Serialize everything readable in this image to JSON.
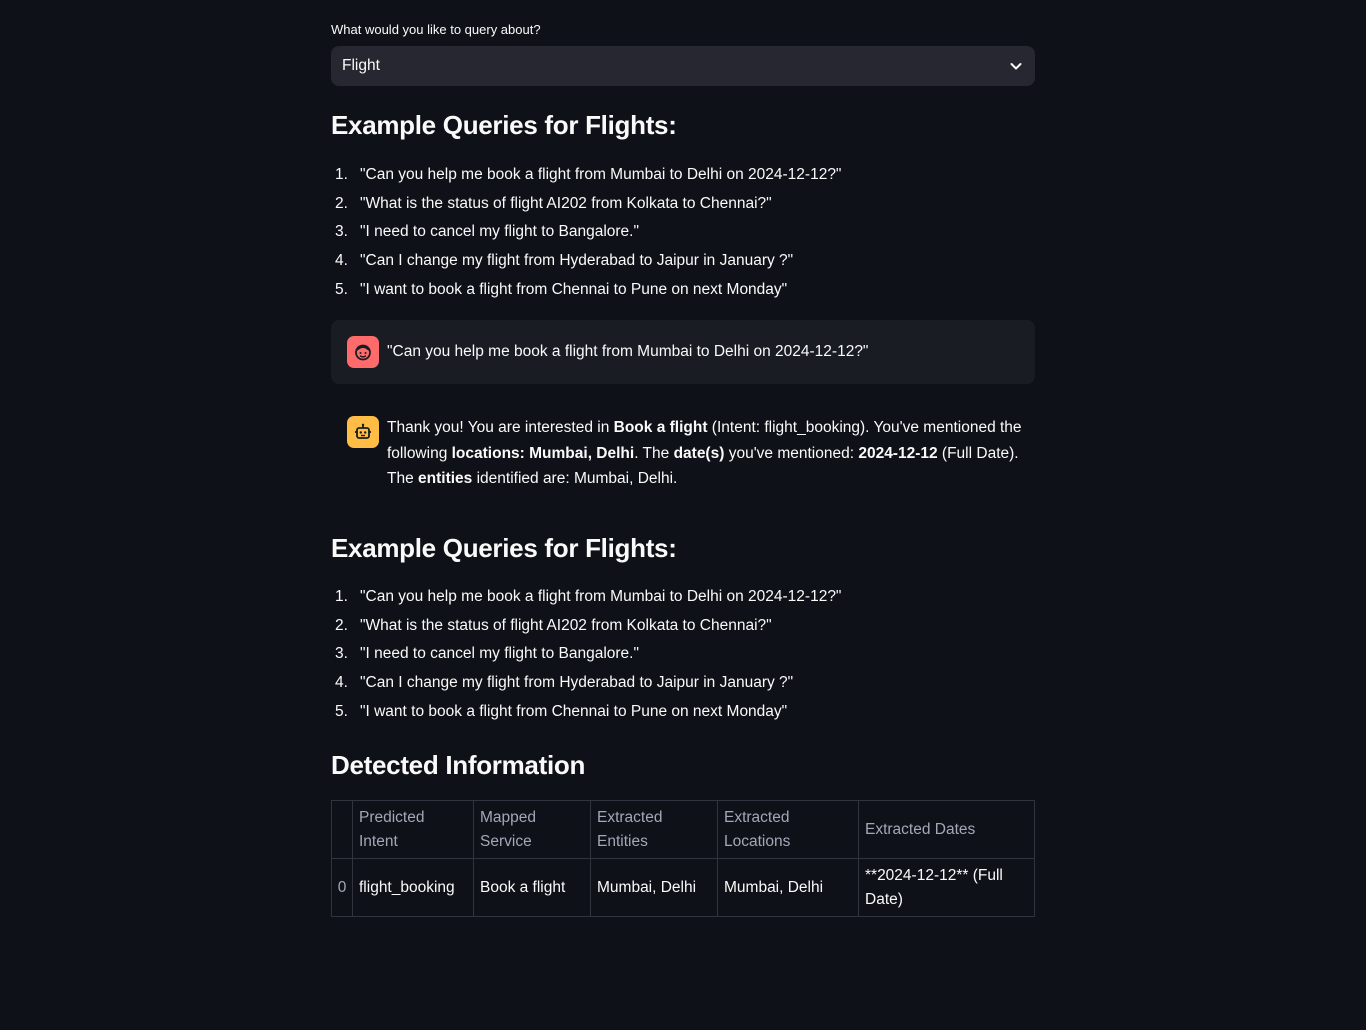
{
  "selector": {
    "label": "What would you like to query about?",
    "value": "Flight"
  },
  "examples": {
    "heading": "Example Queries for Flights:",
    "items": [
      "\"Can you help me book a flight from Mumbai to Delhi on 2024-12-12?\"",
      "\"What is the status of flight AI202 from Kolkata to Chennai?\"",
      "\"I need to cancel my flight to Bangalore.\"",
      "\"Can I change my flight from Hyderabad to Jaipur in January ?\"",
      "\"I want to book a flight from Chennai to Pune on next Monday\""
    ],
    "numbers": [
      "1.",
      "2.",
      "3.",
      "4.",
      "5."
    ]
  },
  "chat": {
    "user_message": "\"Can you help me book a flight from Mumbai to Delhi on 2024-12-12?\"",
    "bot": {
      "t1": "Thank you! You are interested in ",
      "b1": "Book a flight",
      "t2": " (Intent: flight_booking). You've mentioned the following ",
      "b2": "locations: Mumbai, Delhi",
      "t3": ". The ",
      "b3": "date(s)",
      "t4": " you've mentioned: ",
      "b4": "2024-12-12",
      "t5": " (Full Date). The ",
      "b5": "entities",
      "t6": " identified are: Mumbai, Delhi."
    }
  },
  "detected": {
    "heading": "Detected Information",
    "columns": [
      "Predicted Intent",
      "Mapped Service",
      "Extracted Entities",
      "Extracted Locations",
      "Extracted Dates"
    ],
    "row": {
      "index": "0",
      "cells": [
        "flight_booking",
        "Book a flight",
        "Mumbai, Delhi",
        "Mumbai, Delhi",
        "**2024-12-12** (Full Date)"
      ]
    }
  },
  "colors": {
    "background": "#0e1117",
    "user_avatar": "#ff6b6b",
    "bot_avatar": "#ffbd45"
  },
  "icons": {
    "select": "chevron-down-icon",
    "user_avatar": "face-icon",
    "bot_avatar": "robot-icon"
  }
}
